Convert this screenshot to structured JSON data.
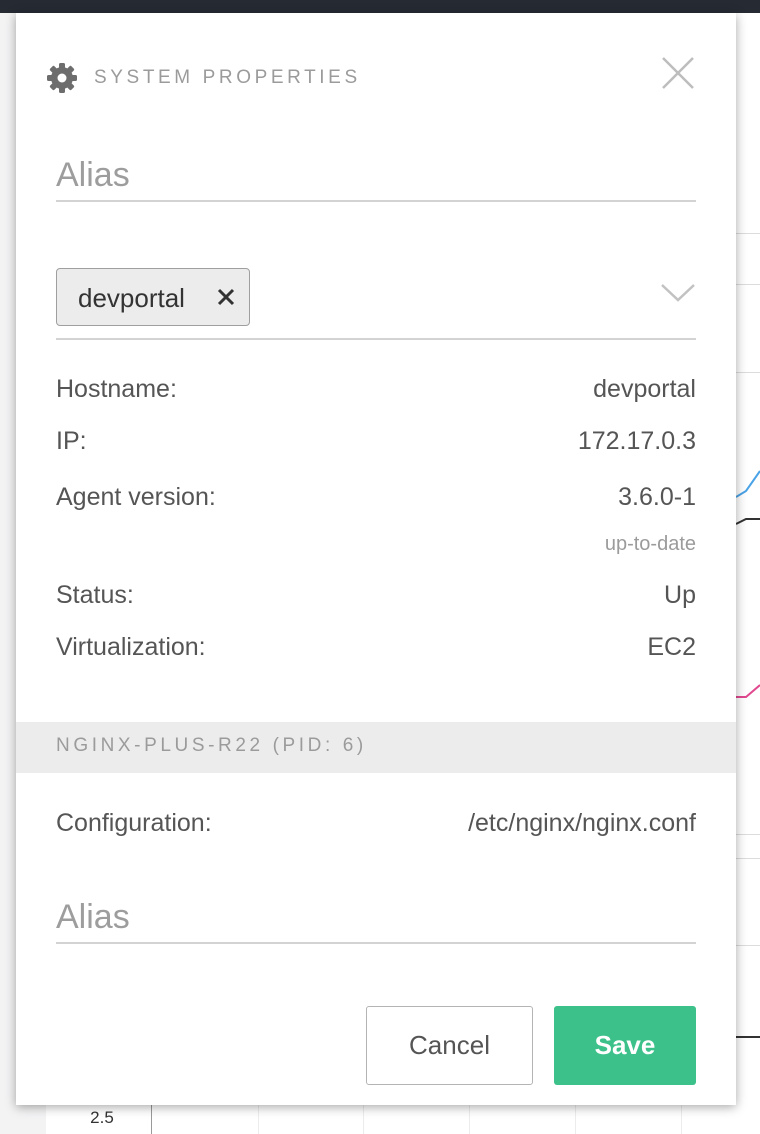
{
  "background": {
    "axis_tick": "2.5",
    "line_colors": [
      "#4aa3e6",
      "#333333",
      "#e1498f"
    ]
  },
  "modal": {
    "header": {
      "icon": "gear-icon",
      "title": "SYSTEM PROPERTIES",
      "close_icon": "close-icon"
    },
    "alias_top": {
      "placeholder": "Alias",
      "value": ""
    },
    "tags": {
      "items": [
        {
          "label": "devportal",
          "remove_icon": "x-icon"
        }
      ],
      "dropdown_icon": "chevron-down-icon"
    },
    "properties": [
      {
        "label": "Hostname:",
        "value": "devportal"
      },
      {
        "label": "IP:",
        "value": "172.17.0.3"
      },
      {
        "label": "Agent version:",
        "value": "3.6.0-1",
        "sub": "up-to-date"
      },
      {
        "label": "Status:",
        "value": "Up"
      },
      {
        "label": "Virtualization:",
        "value": "EC2"
      }
    ],
    "nginx_section": {
      "title": "NGINX-PLUS-R22 (PID: 6)",
      "configuration_label": "Configuration:",
      "configuration_value": "/etc/nginx/nginx.conf",
      "alias": {
        "placeholder": "Alias",
        "value": ""
      }
    },
    "buttons": {
      "cancel": "Cancel",
      "save": "Save"
    },
    "colors": {
      "save_button": "#3cc18a",
      "section_band": "#ececec",
      "text": "#555555",
      "muted": "#9b9b9b"
    }
  }
}
